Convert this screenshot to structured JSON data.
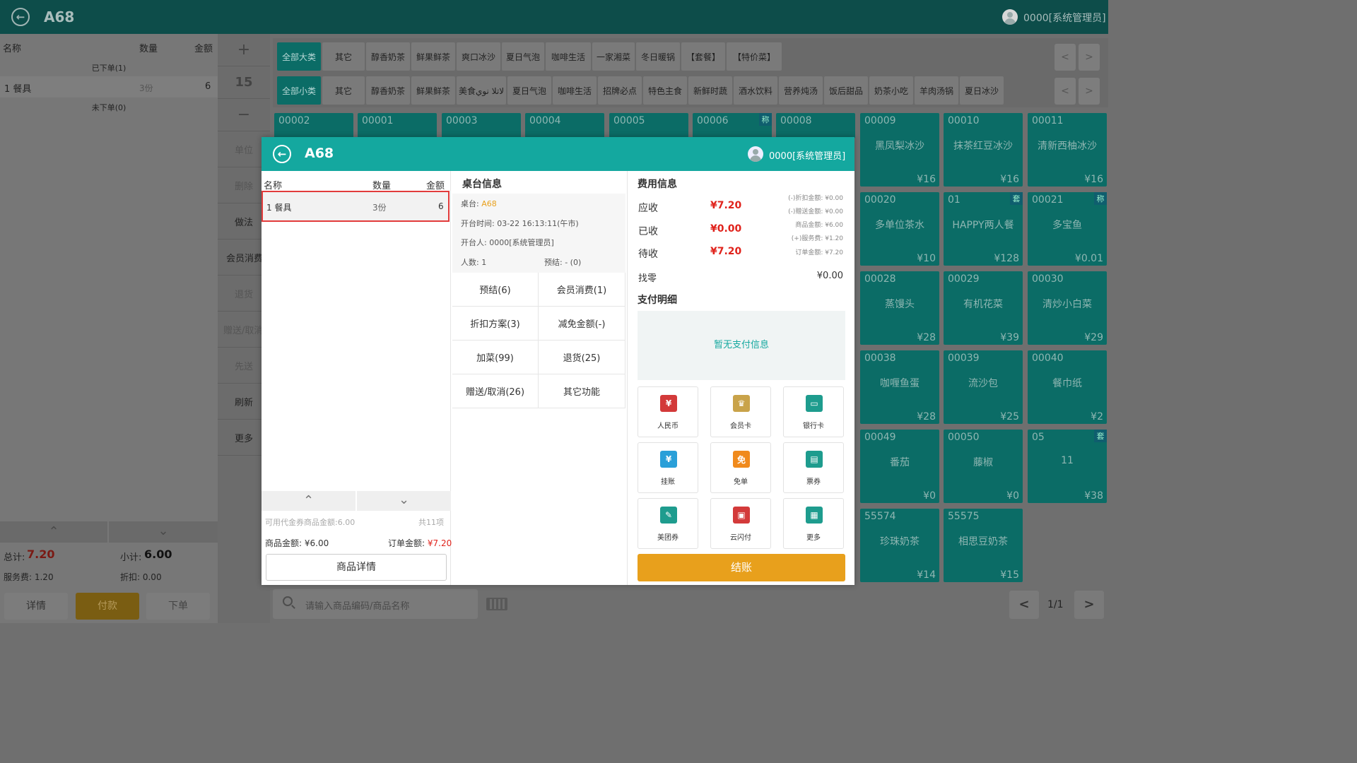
{
  "header": {
    "title": "A68",
    "user": "0000[系统管理员]"
  },
  "left": {
    "col_name": "名称",
    "col_qty": "数量",
    "col_amount": "金额",
    "ordered_label": "已下单(1)",
    "row": {
      "name": "1 餐具",
      "qty": "3份",
      "amount": "6"
    },
    "unordered_label": "未下单(0)",
    "total_label": "总计:",
    "total_value": "7.20",
    "subtotal_label": "小计:",
    "subtotal_value": "6.00",
    "service_label": "服务费: 1.20",
    "discount_label": "折扣: 0.00",
    "btn_detail": "详情",
    "btn_pay": "付款",
    "btn_order": "下单"
  },
  "side": {
    "plus": "+",
    "qty": "15",
    "minus": "−",
    "buttons": [
      "单位",
      "删除",
      "做法",
      "会员消费",
      "退货",
      "赠送/取消",
      "先送",
      "刷新",
      "更多"
    ]
  },
  "categories_main": [
    "全部大类",
    "其它",
    "醇香奶茶",
    "鲜果鲜茶",
    "爽口冰沙",
    "夏日气泡",
    "咖啡生活",
    "一家湘菜",
    "冬日暖锅",
    "【套餐】",
    "【特价菜】"
  ],
  "categories_sub": [
    "全部小类",
    "其它",
    "醇香奶茶",
    "鲜果鲜茶",
    "美食لاتلا نوي",
    "夏日气泡",
    "咖啡生活",
    "招牌必点",
    "特色主食",
    "新鲜时蔬",
    "酒水饮料",
    "营养炖汤",
    "饭后甜品",
    "奶茶小吃",
    "羊肉汤锅",
    "夏日冰沙"
  ],
  "arrows": {
    "left": "<",
    "right": ">"
  },
  "tiles_top": [
    "00002",
    "00001",
    "00003",
    "00004",
    "00005",
    "00006",
    "00008"
  ],
  "tiles_top_tag": "称",
  "tiles": [
    {
      "code": "00009",
      "name": "黑凤梨冰沙",
      "price": "¥16",
      "tag": ""
    },
    {
      "code": "00010",
      "name": "抹茶红豆冰沙",
      "price": "¥16",
      "tag": ""
    },
    {
      "code": "00011",
      "name": "清新西柚冰沙",
      "price": "¥16",
      "tag": ""
    },
    {
      "code": "00020",
      "name": "多单位茶水",
      "price": "¥10",
      "tag": ""
    },
    {
      "code": "01",
      "name": "HAPPY两人餐",
      "price": "¥128",
      "tag": "套"
    },
    {
      "code": "00021",
      "name": "多宝鱼",
      "price": "¥0.01",
      "tag": "称"
    },
    {
      "code": "00028",
      "name": "蒸馒头",
      "price": "¥28",
      "tag": ""
    },
    {
      "code": "00029",
      "name": "有机花菜",
      "price": "¥39",
      "tag": ""
    },
    {
      "code": "00030",
      "name": "清炒小白菜",
      "price": "¥29",
      "tag": ""
    },
    {
      "code": "00038",
      "name": "咖喱鱼蛋",
      "price": "¥28",
      "tag": ""
    },
    {
      "code": "00039",
      "name": "流沙包",
      "price": "¥25",
      "tag": ""
    },
    {
      "code": "00040",
      "name": "餐巾纸",
      "price": "¥2",
      "tag": ""
    },
    {
      "code": "00049",
      "name": "番茄",
      "price": "¥0",
      "tag": ""
    },
    {
      "code": "00050",
      "name": "藤椒",
      "price": "¥0",
      "tag": ""
    },
    {
      "code": "05",
      "name": "11",
      "price": "¥38",
      "tag": "套"
    },
    {
      "code": "55574",
      "name": "珍珠奶茶",
      "price": "¥14",
      "tag": ""
    },
    {
      "code": "55575",
      "name": "相思豆奶茶",
      "price": "¥15",
      "tag": ""
    }
  ],
  "search": {
    "placeholder": "请输入商品编码/商品名称"
  },
  "pager": {
    "text": "1/1"
  },
  "modal": {
    "title": "A68",
    "user": "0000[系统管理员]",
    "list": {
      "col_name": "名称",
      "col_qty": "数量",
      "col_amount": "金额",
      "row": {
        "name": "1 餐具",
        "qty": "3份",
        "amount": "6"
      }
    },
    "voucher": "可用代金券商品金额:6.00",
    "count": "共11项",
    "goods_amount": "商品金额: ¥6.00",
    "order_amount_label": "订单金额: ",
    "order_amount": "¥7.20",
    "detail_btn": "商品详情",
    "table_info": {
      "title": "桌台信息",
      "table_label": "桌台: ",
      "table": "A68",
      "open_time": "开台时间: 03-22 16:13:11(午市)",
      "opener": "开台人: 0000[系统管理员]",
      "people": "人数: 1",
      "reserve": "预结: - (0)"
    },
    "actions": [
      "预结(6)",
      "会员消费(1)",
      "折扣方案(3)",
      "减免金额(-)",
      "加菜(99)",
      "退货(25)",
      "赠送/取消(26)",
      "其它功能"
    ],
    "fee": {
      "title": "费用信息",
      "due_label": "应收",
      "due": "¥7.20",
      "paid_label": "已收",
      "paid": "¥0.00",
      "pending_label": "待收",
      "pending": "¥7.20",
      "notes": [
        "(-)折扣金额: ¥0.00",
        "(-)赠送金额: ¥0.00",
        "商品金额: ¥6.00",
        "(+)服务费: ¥1.20",
        "订单金额: ¥7.20"
      ],
      "change_label": "找零",
      "change": "¥0.00"
    },
    "pay_detail": {
      "title": "支付明细",
      "empty": "暂无支付信息"
    },
    "pay_methods": [
      {
        "label": "人民币",
        "icon": "rmb-icon",
        "color": "#d33a3a",
        "glyph": "¥"
      },
      {
        "label": "会员卡",
        "icon": "member-card-icon",
        "color": "#c9a34a",
        "glyph": "♛"
      },
      {
        "label": "银行卡",
        "icon": "bank-card-icon",
        "color": "#1e9c8e",
        "glyph": "▭"
      },
      {
        "label": "挂账",
        "icon": "credit-icon",
        "color": "#2a9fd8",
        "glyph": "¥"
      },
      {
        "label": "免单",
        "icon": "free-order-icon",
        "color": "#f08a1c",
        "glyph": "免"
      },
      {
        "label": "票券",
        "icon": "coupon-icon",
        "color": "#1e9c8e",
        "glyph": "▤"
      },
      {
        "label": "美团券",
        "icon": "meituan-icon",
        "color": "#1e9c8e",
        "glyph": "✎"
      },
      {
        "label": "云闪付",
        "icon": "unionpay-icon",
        "color": "#d33a3a",
        "glyph": "▣"
      },
      {
        "label": "更多",
        "icon": "more-icon",
        "color": "#1e9c8e",
        "glyph": "▦"
      }
    ],
    "settle_btn": "结账"
  },
  "colors": {
    "teal": "#14a89f",
    "dark_teal": "#0b6c66",
    "orange": "#e8a01c",
    "red": "#e0231c"
  }
}
